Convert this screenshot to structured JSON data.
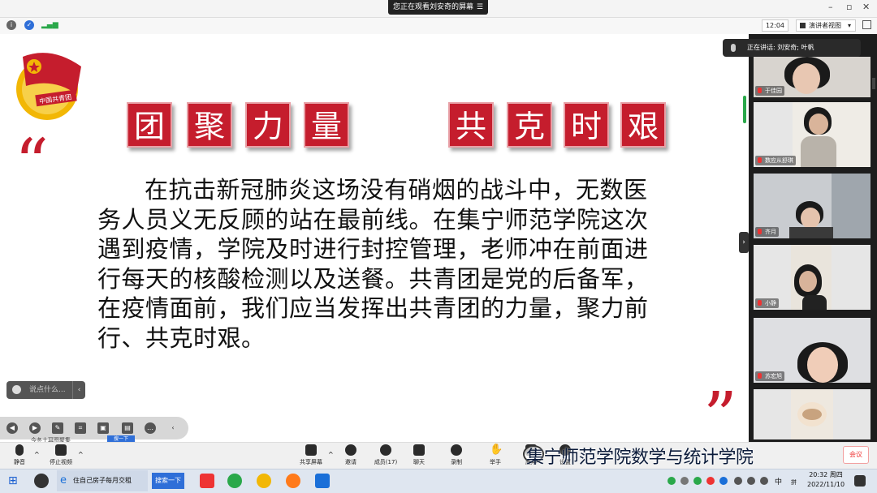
{
  "topbar": {
    "sharing_banner": "您正在观看刘安奇的屏幕",
    "minimize": "–",
    "maximize": "▫",
    "close": "✕"
  },
  "toolbar": {
    "clock": "12:04",
    "view_label": "演讲者视图",
    "view_arrow": "▾"
  },
  "slide": {
    "banner_left": [
      "团",
      "聚",
      "力",
      "量"
    ],
    "banner_right": [
      "共",
      "克",
      "时",
      "艰"
    ],
    "quote_open": "“",
    "quote_close": "”",
    "body": "在抗击新冠肺炎这场没有硝烟的战斗中，无数医务人员义无反顾的站在最前线。在集宁师范学院这次遇到疫情，学院及时进行封控管理，老师冲在前面进行每天的核酸检测以及送餐。共青团是党的后备军，在疫情面前，我们应当发挥出共青团的力量，聚力前行、共克时艰。",
    "emblem_text": "中国共青团",
    "emblem_color": "#c51d2d"
  },
  "chat": {
    "placeholder": "说点什么...",
    "arrow": "‹"
  },
  "annot": {
    "small_label": "今冬土耳图聚集",
    "blue_label": "搜一下"
  },
  "speaker": {
    "text": "正在讲话: 刘安奇; 叶帆"
  },
  "participants": [
    {
      "name": "于佳园"
    },
    {
      "name": "数应从舒琪"
    },
    {
      "name": "齐月"
    },
    {
      "name": "小静"
    },
    {
      "name": "苏宏旭"
    },
    {
      "name": ""
    }
  ],
  "meeting_toolbar": {
    "mute": "静音",
    "stop_video": "停止视频",
    "share": "共享屏幕",
    "invite": "邀请",
    "members": "成员(17)",
    "chat": "聊天",
    "record": "录制",
    "raise_hand": "举手",
    "apps": "应用",
    "settings": "设置",
    "end": "会议"
  },
  "watermark": "集宁师范学院数学与统计学院",
  "taskbar": {
    "window_title": "住自己房子每月交租",
    "search_btn": "搜索一下",
    "ime": "中",
    "time": "20:32 周四",
    "date": "2022/11/10",
    "lang": "拼"
  }
}
